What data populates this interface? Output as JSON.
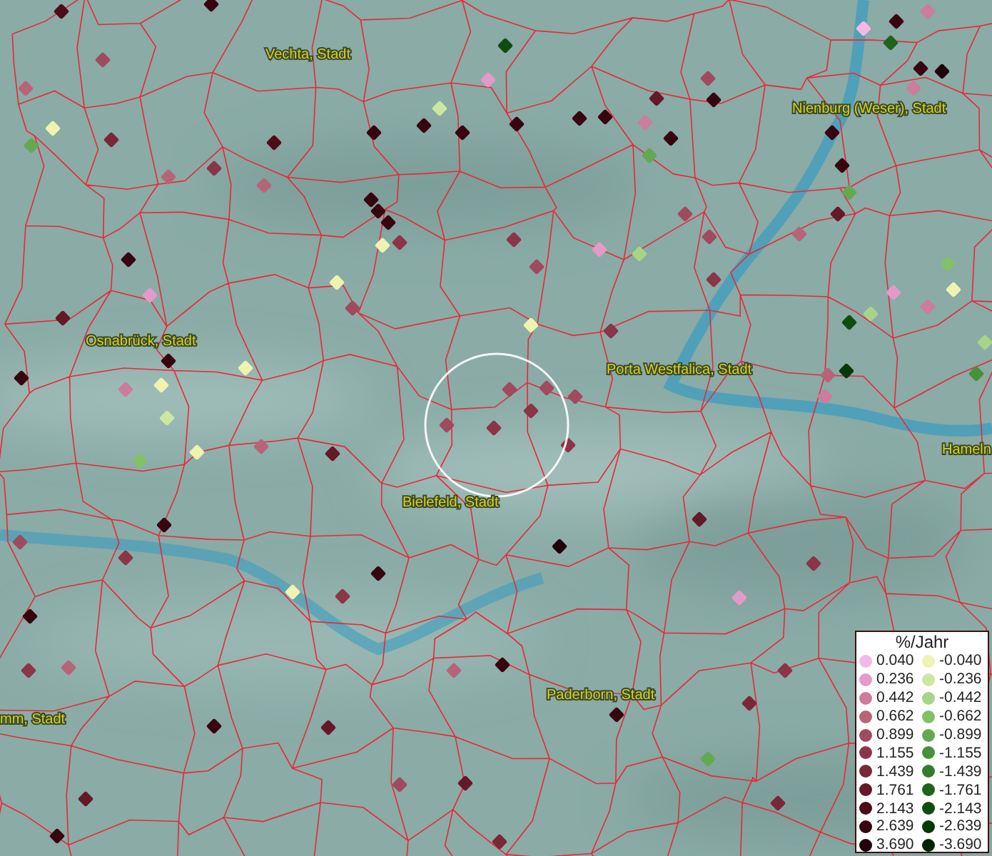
{
  "map": {
    "places": [
      {
        "name": "Vechta, Stadt"
      },
      {
        "name": "Nienburg (Weser), Stadt"
      },
      {
        "name": "Osnabrück, Stadt"
      },
      {
        "name": "Porta Westfalica, Stadt"
      },
      {
        "name": "Bielefeld, Stadt"
      },
      {
        "name": "Paderborn, Stadt"
      },
      {
        "name": "Hameln"
      },
      {
        "name": "mm, Stadt"
      }
    ]
  },
  "legend": {
    "title": "%/Jahr",
    "positive": [
      {
        "value": "0.040",
        "color": "#f4b8e4"
      },
      {
        "value": "0.236",
        "color": "#e49ac8"
      },
      {
        "value": "0.442",
        "color": "#cc7c9c"
      },
      {
        "value": "0.662",
        "color": "#b86478"
      },
      {
        "value": "0.899",
        "color": "#a04a60"
      },
      {
        "value": "1.155",
        "color": "#8c3448"
      },
      {
        "value": "1.439",
        "color": "#782838"
      },
      {
        "value": "1.761",
        "color": "#641828"
      },
      {
        "value": "2.143",
        "color": "#4c0c18"
      },
      {
        "value": "2.639",
        "color": "#380410"
      },
      {
        "value": "3.690",
        "color": "#200008"
      }
    ],
    "negative": [
      {
        "value": "-0.040",
        "color": "#eef4b0"
      },
      {
        "value": "-0.236",
        "color": "#cce8a0"
      },
      {
        "value": "-0.442",
        "color": "#a8d488"
      },
      {
        "value": "-0.662",
        "color": "#84c068"
      },
      {
        "value": "-0.899",
        "color": "#64a850"
      },
      {
        "value": "-1.155",
        "color": "#48903c"
      },
      {
        "value": "-1.439",
        "color": "#347c2c"
      },
      {
        "value": "-1.761",
        "color": "#20641c"
      },
      {
        "value": "-2.143",
        "color": "#104c10"
      },
      {
        "value": "-2.639",
        "color": "#083808"
      },
      {
        "value": "-3.690",
        "color": "#042404"
      }
    ]
  }
}
